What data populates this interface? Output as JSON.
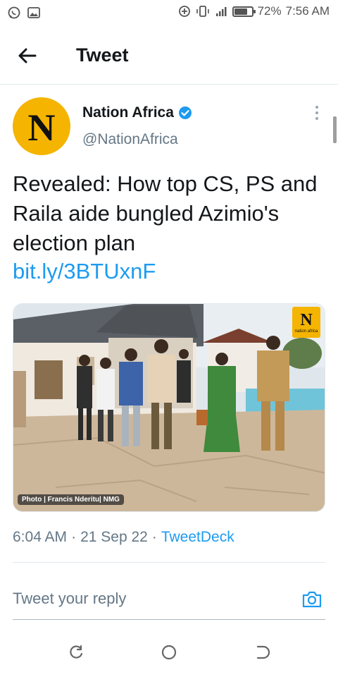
{
  "status_bar": {
    "battery_percent_text": "72%",
    "battery_level": 0.72,
    "time": "7:56 AM",
    "left_icons": [
      "whatsapp-icon",
      "gallery-icon"
    ],
    "right_icons": [
      "data-saver-icon",
      "vibrate-icon",
      "signal-icon",
      "battery-icon"
    ]
  },
  "header": {
    "title": "Tweet",
    "back_icon": "arrow-left-icon"
  },
  "tweet": {
    "author_name": "Nation Africa",
    "author_handle": "@NationAfrica",
    "avatar_letter": "N",
    "verified": true,
    "text": "Revealed: How top CS, PS and Raila aide bungled Azimio's election plan",
    "link": "bit.ly/3BTUxnF",
    "media": {
      "credit": "Photo | Francis Nderitu| NMG",
      "logo_letter": "N",
      "logo_text": "nation africa"
    },
    "time": "6:04 AM",
    "separator": "·",
    "date": "21 Sep 22",
    "source": "TweetDeck"
  },
  "reply": {
    "placeholder": "Tweet your reply",
    "camera_icon": "camera-icon"
  },
  "colors": {
    "accent": "#1d9bf0",
    "brand_yellow": "#f4b400",
    "text_primary": "#14171a",
    "text_secondary": "#657786"
  }
}
